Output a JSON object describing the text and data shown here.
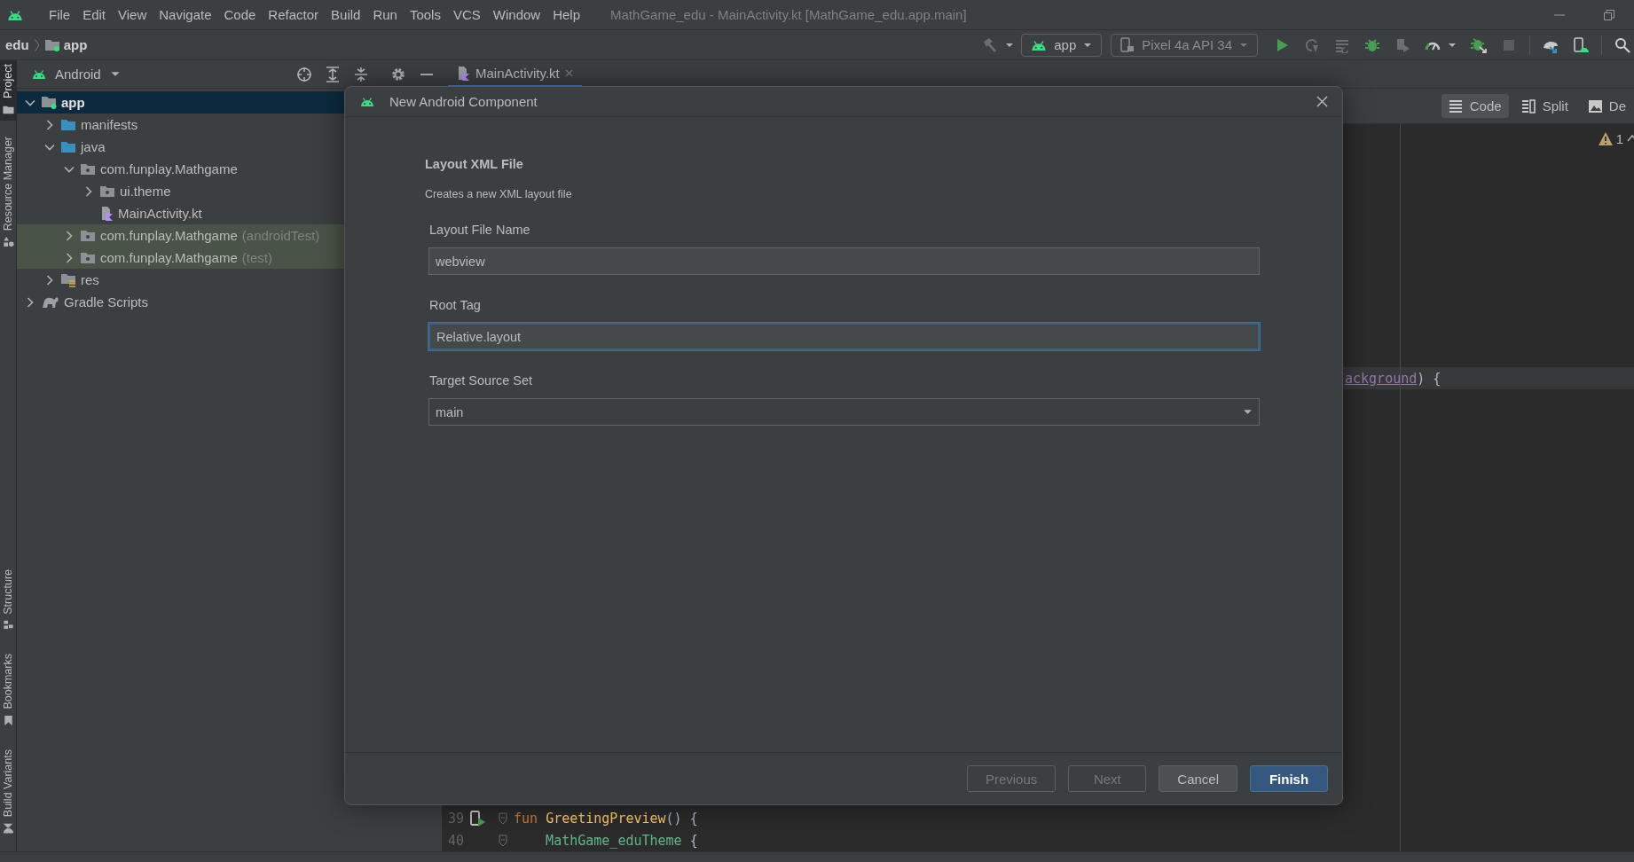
{
  "menu_bar": {
    "items": [
      "File",
      "Edit",
      "View",
      "Navigate",
      "Code",
      "Refactor",
      "Build",
      "Run",
      "Tools",
      "VCS",
      "Window",
      "Help"
    ],
    "title": "MathGame_edu - MainActivity.kt [MathGame_edu.app.main]"
  },
  "nav_bar": {
    "breadcrumbs": [
      "edu",
      "app"
    ],
    "run_config": "app",
    "device": "Pixel 4a API 34"
  },
  "tool_stripe": [
    {
      "label": "Project",
      "selected": true
    },
    {
      "label": "Resource Manager",
      "selected": false
    },
    {
      "label": "Structure",
      "selected": false
    },
    {
      "label": "Bookmarks",
      "selected": false
    },
    {
      "label": "Build Variants",
      "selected": false
    }
  ],
  "project_panel": {
    "view": "Android",
    "tree": [
      {
        "label": "app",
        "kind": "module",
        "expanded": true,
        "selected": true,
        "highlighted": false,
        "children": [
          {
            "label": "manifests",
            "kind": "folder",
            "expanded": false,
            "selected": false,
            "highlighted": false
          },
          {
            "label": "java",
            "kind": "folder",
            "expanded": true,
            "selected": false,
            "highlighted": false,
            "children": [
              {
                "label": "com.funplay.Mathgame",
                "kind": "package",
                "expanded": true,
                "selected": false,
                "highlighted": false,
                "children": [
                  {
                    "label": "ui.theme",
                    "kind": "package",
                    "expanded": false,
                    "selected": false,
                    "highlighted": false
                  },
                  {
                    "label": "MainActivity.kt",
                    "kind": "kotlin",
                    "selected": false,
                    "highlighted": false
                  }
                ]
              },
              {
                "label": "com.funplay.Mathgame",
                "suffix": "(androidTest)",
                "kind": "package",
                "expanded": false,
                "selected": false,
                "highlighted": true
              },
              {
                "label": "com.funplay.Mathgame",
                "suffix": "(test)",
                "kind": "package",
                "expanded": false,
                "selected": false,
                "highlighted": true
              }
            ]
          },
          {
            "label": "res",
            "kind": "resources",
            "expanded": false,
            "selected": false,
            "highlighted": false
          }
        ]
      },
      {
        "label": "Gradle Scripts",
        "kind": "gradle",
        "expanded": false,
        "selected": false,
        "highlighted": false
      }
    ]
  },
  "editor": {
    "tabs": [
      {
        "label": "MainActivity.kt",
        "selected": true
      }
    ],
    "view_modes": [
      {
        "label": "Code",
        "selected": true
      },
      {
        "label": "Split",
        "selected": false
      },
      {
        "label": "De",
        "selected": false
      }
    ],
    "warning_count": "1",
    "code_lines": [
      {
        "kind": "clipped",
        "current": true,
        "tokens": [
          {
            "text": "ackground",
            "kind": "parameter"
          },
          {
            "text": ") {",
            "kind": "plain"
          }
        ]
      },
      {
        "kind": "numbered",
        "number": "39",
        "current": false,
        "tokens": [
          {
            "text": "fun ",
            "kind": "keyword"
          },
          {
            "text": "GreetingPreview",
            "kind": "function"
          },
          {
            "text": "() {",
            "kind": "plain"
          }
        ]
      },
      {
        "kind": "numbered",
        "number": "40",
        "current": false,
        "tokens": [
          {
            "text": "    MathGame_eduTheme",
            "kind": "composable"
          },
          {
            "text": " {",
            "kind": "plain"
          }
        ]
      }
    ]
  },
  "dialog": {
    "title": "New Android Component",
    "heading": "Layout XML File",
    "description": "Creates a new XML layout file",
    "fields": [
      {
        "label": "Layout File Name",
        "value": "webview",
        "kind": "text",
        "focused": false
      },
      {
        "label": "Root Tag",
        "value": "Relative.layout",
        "kind": "text",
        "focused": true
      },
      {
        "label": "Target Source Set",
        "value": "main",
        "kind": "dropdown",
        "focused": false
      }
    ],
    "buttons": [
      {
        "label": "Previous",
        "disabled": true,
        "primary": false
      },
      {
        "label": "Next",
        "disabled": true,
        "primary": false
      },
      {
        "label": "Cancel",
        "disabled": false,
        "primary": false
      },
      {
        "label": "Finish",
        "disabled": false,
        "primary": true
      }
    ]
  }
}
